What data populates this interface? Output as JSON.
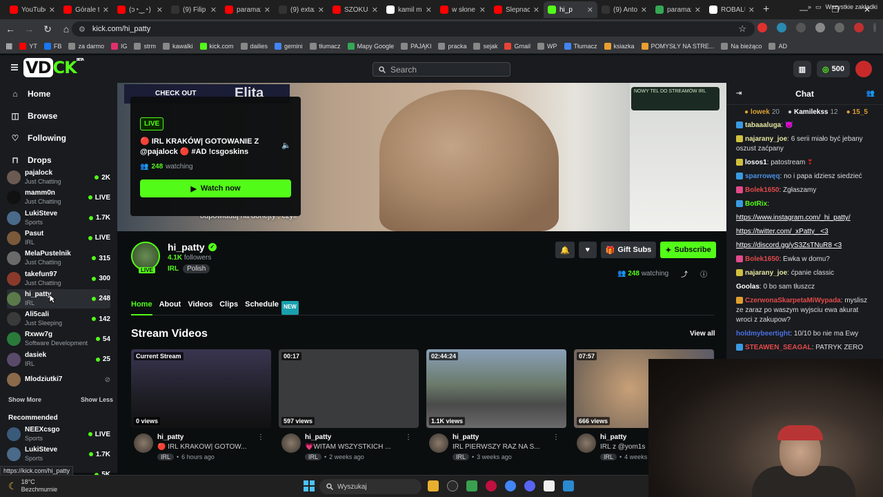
{
  "browser": {
    "tabs": [
      {
        "title": "YouTube",
        "color": "#ff0000"
      },
      {
        "title": "Górale t",
        "color": "#ff0000"
      },
      {
        "title": "(ɔ◔‿◔)",
        "color": "#ff0000"
      },
      {
        "title": "(9) Filip",
        "color": "#333333"
      },
      {
        "title": "paramax",
        "color": "#ff0000"
      },
      {
        "title": "(9) extaz",
        "color": "#333333"
      },
      {
        "title": "SZOKUJ",
        "color": "#ff0000"
      },
      {
        "title": "kamil mi",
        "color": "#ffffff"
      },
      {
        "title": "w słone",
        "color": "#ff0000"
      },
      {
        "title": "Ślepnac",
        "color": "#ff0000"
      },
      {
        "title": "hi_p",
        "color": "#53fc18",
        "active": true
      },
      {
        "title": "(9) Anto",
        "color": "#333333"
      },
      {
        "title": "paramax",
        "color": "#34a853"
      },
      {
        "title": "ROBALU",
        "color": "#ffffff"
      }
    ],
    "url": "kick.com/hi_patty",
    "bookmarks": [
      "YT",
      "FB",
      "za darmo",
      "IG",
      "strm",
      "kawalki",
      "kick.com",
      "dailies",
      "gemini",
      "tłumacz",
      "Mapy Google",
      "PAJĄKI",
      "pracka",
      "sejak",
      "Gmail",
      "WP",
      "Tłumacz",
      "ksiazka",
      "POMYSŁY NA STRE...",
      "Na bieżąco",
      "AD"
    ],
    "all_bookmarks": "Wszystkie zakładki",
    "status_url": "https://kick.com/hi_patty"
  },
  "header": {
    "search_placeholder": "Search",
    "points": "500",
    "logo_badge": "BETA"
  },
  "sidebar": {
    "nav": [
      {
        "label": "Home",
        "icon": "⌂"
      },
      {
        "label": "Browse",
        "icon": "◫"
      },
      {
        "label": "Following",
        "icon": "♡"
      },
      {
        "label": "Drops",
        "icon": "⊓"
      }
    ],
    "following": [
      {
        "name": "pajalock",
        "category": "Just Chatting",
        "count": "2K",
        "color": "#6a5a52"
      },
      {
        "name": "mamm0n",
        "category": "Just Chatting",
        "count": "LIVE",
        "color": "#111111"
      },
      {
        "name": "LukiSteve",
        "category": "Sports",
        "count": "1.7K",
        "color": "#4a6a8a"
      },
      {
        "name": "Pasut",
        "category": "IRL",
        "count": "LIVE",
        "color": "#7a5a3a"
      },
      {
        "name": "MelaPustelnik",
        "category": "Just Chatting",
        "count": "315",
        "color": "#6a6a6a"
      },
      {
        "name": "takefun97",
        "category": "Just Chatting",
        "count": "300",
        "color": "#8a3a2a"
      },
      {
        "name": "hi_patty",
        "category": "IRL",
        "count": "248",
        "color": "#5a7a4a"
      },
      {
        "name": "Ali5cali",
        "category": "Just Sleeping",
        "count": "142",
        "color": "#3a3a3a"
      },
      {
        "name": "Rxww7g",
        "category": "Software Development",
        "count": "54",
        "color": "#2a7a3a"
      },
      {
        "name": "dasiek",
        "category": "IRL",
        "count": "25",
        "color": "#5a4a6a"
      },
      {
        "name": "Mlodziutki7",
        "category": "",
        "count": "",
        "color": "#8a6a4a"
      }
    ],
    "show_more": "Show More",
    "show_less": "Show Less",
    "recommended_title": "Recommended",
    "recommended": [
      {
        "name": "NEEXcsgo",
        "category": "Sports",
        "count": "LIVE",
        "color": "#3a5a7a"
      },
      {
        "name": "LukiSteve",
        "category": "Sports",
        "count": "1.7K",
        "color": "#4a6a8a"
      },
      {
        "name": "",
        "category": "",
        "count": "5K",
        "color": "#191b1f"
      }
    ]
  },
  "player": {
    "banner": "CHECK OUT",
    "big_text": "Elita",
    "promo": "NOWY TEL DO STREAMÓW IRL",
    "subtitle": "odpowiadaj na donejty , czyli",
    "overlay": {
      "live": "LIVE",
      "title": "🔴 IRL KRAKÓW| GOTOWANIE Z @pajalock 🔴 #AD !csgoskins",
      "watching_count": "248",
      "watching_label": "watching",
      "watch_now": "Watch now"
    }
  },
  "channel": {
    "name": "hi_patty",
    "followers_count": "4.1K",
    "followers_label": "followers",
    "category": "IRL",
    "language": "Polish",
    "live_badge": "LIVE",
    "gift_subs": "Gift Subs",
    "subscribe": "Subscribe",
    "watching_count": "248",
    "watching_label": "watching",
    "tabs": [
      "Home",
      "About",
      "Videos",
      "Clips",
      "Schedule"
    ],
    "new_badge": "NEW"
  },
  "stream_videos": {
    "title": "Stream Videos",
    "view_all": "View all",
    "cards": [
      {
        "badge": "Current Stream",
        "views": "0 views",
        "streamer": "hi_patty",
        "title": "🔴 IRL KRAKÓW| GOTOW...",
        "tag": "IRL",
        "age": "6 hours ago",
        "thumb": "#2a2c3a"
      },
      {
        "badge": "00:17",
        "views": "597 views",
        "streamer": "hi_patty",
        "title": "💗WITAM WSZYSTKICH ...",
        "tag": "IRL",
        "age": "2 weeks ago",
        "thumb": "#3a3b3d"
      },
      {
        "badge": "02:44:24",
        "views": "1.1K views",
        "streamer": "hi_patty",
        "title": "IRL PIERWSZY RAZ NA S...",
        "tag": "IRL",
        "age": "3 weeks ago",
        "thumb": "#6a7a8a"
      },
      {
        "badge": "07:57",
        "views": "666 views",
        "streamer": "hi_patty",
        "title": "IRL z @yom1s",
        "tag": "IRL",
        "age": "4 weeks",
        "thumb": "#7a6a5a"
      }
    ]
  },
  "chat": {
    "title": "Chat",
    "pinned": [
      {
        "name": "lowek",
        "value": "20",
        "color": "#e0a030"
      },
      {
        "name": "Kamilekss",
        "value": "12",
        "color": "#cccccc"
      },
      {
        "name": "15_5",
        "value": "",
        "color": "#e0a030"
      }
    ],
    "messages": [
      {
        "user": "tabaaaluga",
        "color": "#e6e6a0",
        "text": "",
        "badge": "#3a9ae0"
      },
      {
        "user": "najarany_joe",
        "color": "#e6e6a0",
        "text": "6 serii miało być jebany oszust zaćpany",
        "badge": "#d0c040"
      },
      {
        "user": "losos1",
        "color": "#ffffff",
        "text": "patostream",
        "badge": "#d0c040"
      },
      {
        "user": "sparrowęq",
        "color": "#4a90e2",
        "text": "no i papa idziesz siedzieć",
        "badge": "#3a9ae0"
      },
      {
        "user": "Bolek1650",
        "color": "#e24a4a",
        "text": "Zgłaszamy",
        "badge": "#e24a8a"
      },
      {
        "user": "BotRix",
        "color": "#53fc18",
        "text": "",
        "badge": "#3a9ae0"
      },
      {
        "user": "",
        "color": "#ffffff",
        "text": "https://www.instagram.com/_hi_patty/",
        "badge": ""
      },
      {
        "user": "",
        "color": "#ffffff",
        "text": "https://twitter.com/_xPatty_ <3",
        "badge": ""
      },
      {
        "user": "",
        "color": "#ffffff",
        "text": "https://discord.gg/yS3ZsTNuR8 <3",
        "badge": ""
      },
      {
        "user": "Bolek1650",
        "color": "#e24a4a",
        "text": "Ewka w domu?",
        "badge": "#e24a8a"
      },
      {
        "user": "najarany_joe",
        "color": "#e6e6a0",
        "text": "ćpanie classic",
        "badge": "#d0c040"
      },
      {
        "user": "Goolas",
        "color": "#ffffff",
        "text": "0 bo sam tłuszcz",
        "badge": ""
      },
      {
        "user": "CzerwonaSkarpetaMiWypada",
        "color": "#e24a4a",
        "text": "myslisz ze zaraz po waszym wyjsciu ewa akurat wroci z zakupow?",
        "badge": "#e0a030"
      },
      {
        "user": "holdmybeertight",
        "color": "#4a70e2",
        "text": "10/10 bo nie ma Ewy",
        "badge": ""
      },
      {
        "user": "STEAWEN_SEAGAL",
        "color": "#e24a4a",
        "text": "PATRYK ZERO",
        "badge": "#3a9ae0"
      }
    ]
  },
  "taskbar": {
    "temp": "18°C",
    "weather": "Bezchmurnie",
    "search": "Wyszukaj"
  }
}
